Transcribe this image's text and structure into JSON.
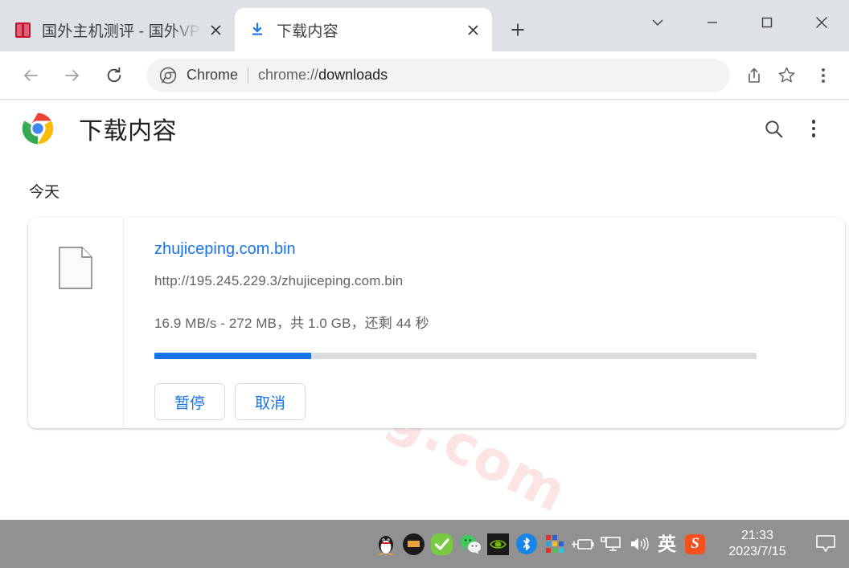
{
  "window": {
    "controls": [
      {
        "name": "tab-search",
        "glyph": "chevron-down"
      },
      {
        "name": "minimize",
        "glyph": "minus"
      },
      {
        "name": "maximize",
        "glyph": "square"
      },
      {
        "name": "close",
        "glyph": "cross"
      }
    ]
  },
  "tabs": [
    {
      "title": "国外主机测评 - 国外VPS，国",
      "favicon": "site-favicon-red",
      "active": false,
      "close_label": "×"
    },
    {
      "title": "下载内容",
      "favicon": "download-icon",
      "active": true,
      "close_label": "×"
    }
  ],
  "newtab": {
    "label": "+",
    "name": "new-tab-button"
  },
  "toolbar": {
    "back": "back-arrow-icon",
    "forward": "forward-arrow-icon",
    "reload": "reload-icon",
    "omnibox": {
      "brand": "Chrome",
      "url_prefix": "chrome://",
      "url_path": "downloads",
      "full_url": "chrome://downloads"
    },
    "share": "share-icon",
    "bookmark": "star-icon",
    "menu": "three-dots-menu-icon"
  },
  "downloads_page": {
    "title": "下载内容",
    "logo": "chrome-logo",
    "search_icon": "search-icon",
    "menu_icon": "three-dots-menu-icon",
    "watermark": "zhujiceping.com",
    "section_label": "今天",
    "item": {
      "file_icon": "generic-file-icon",
      "filename": "zhujiceping.com.bin",
      "url": "http://195.245.229.3/zhujiceping.com.bin",
      "status": "16.9 MB/s - 272 MB，共 1.0 GB，还剩 44 秒",
      "speed": "16.9 MB/s",
      "downloaded": "272 MB",
      "total": "1.0 GB",
      "time_left": "44 秒",
      "progress_percent": 26,
      "progress_color": "#1a73e8",
      "track_color": "#dadce0",
      "buttons": [
        {
          "label": "暂停",
          "name": "pause-download-button"
        },
        {
          "label": "取消",
          "name": "cancel-download-button"
        }
      ]
    }
  },
  "taskbar": {
    "background": "#919191",
    "icons": [
      {
        "name": "qq-icon",
        "type": "qq"
      },
      {
        "name": "media-app-icon",
        "type": "dark"
      },
      {
        "name": "security-check-icon",
        "type": "check"
      },
      {
        "name": "wechat-icon",
        "type": "wechat"
      },
      {
        "name": "nvidia-icon",
        "type": "nvidia"
      },
      {
        "name": "bluetooth-icon",
        "type": "bluetooth"
      },
      {
        "name": "color-squares-icon",
        "type": "squares"
      },
      {
        "name": "battery-icon",
        "type": "battery"
      },
      {
        "name": "network-icon",
        "type": "network"
      },
      {
        "name": "volume-icon",
        "type": "volume"
      },
      {
        "name": "ime-language-icon",
        "type": "ime",
        "label": "英"
      },
      {
        "name": "sogou-input-icon",
        "type": "sogou",
        "label": "S"
      }
    ],
    "clock": {
      "time": "21:33",
      "date": "2023/7/15"
    },
    "notification": "notification-icon"
  }
}
